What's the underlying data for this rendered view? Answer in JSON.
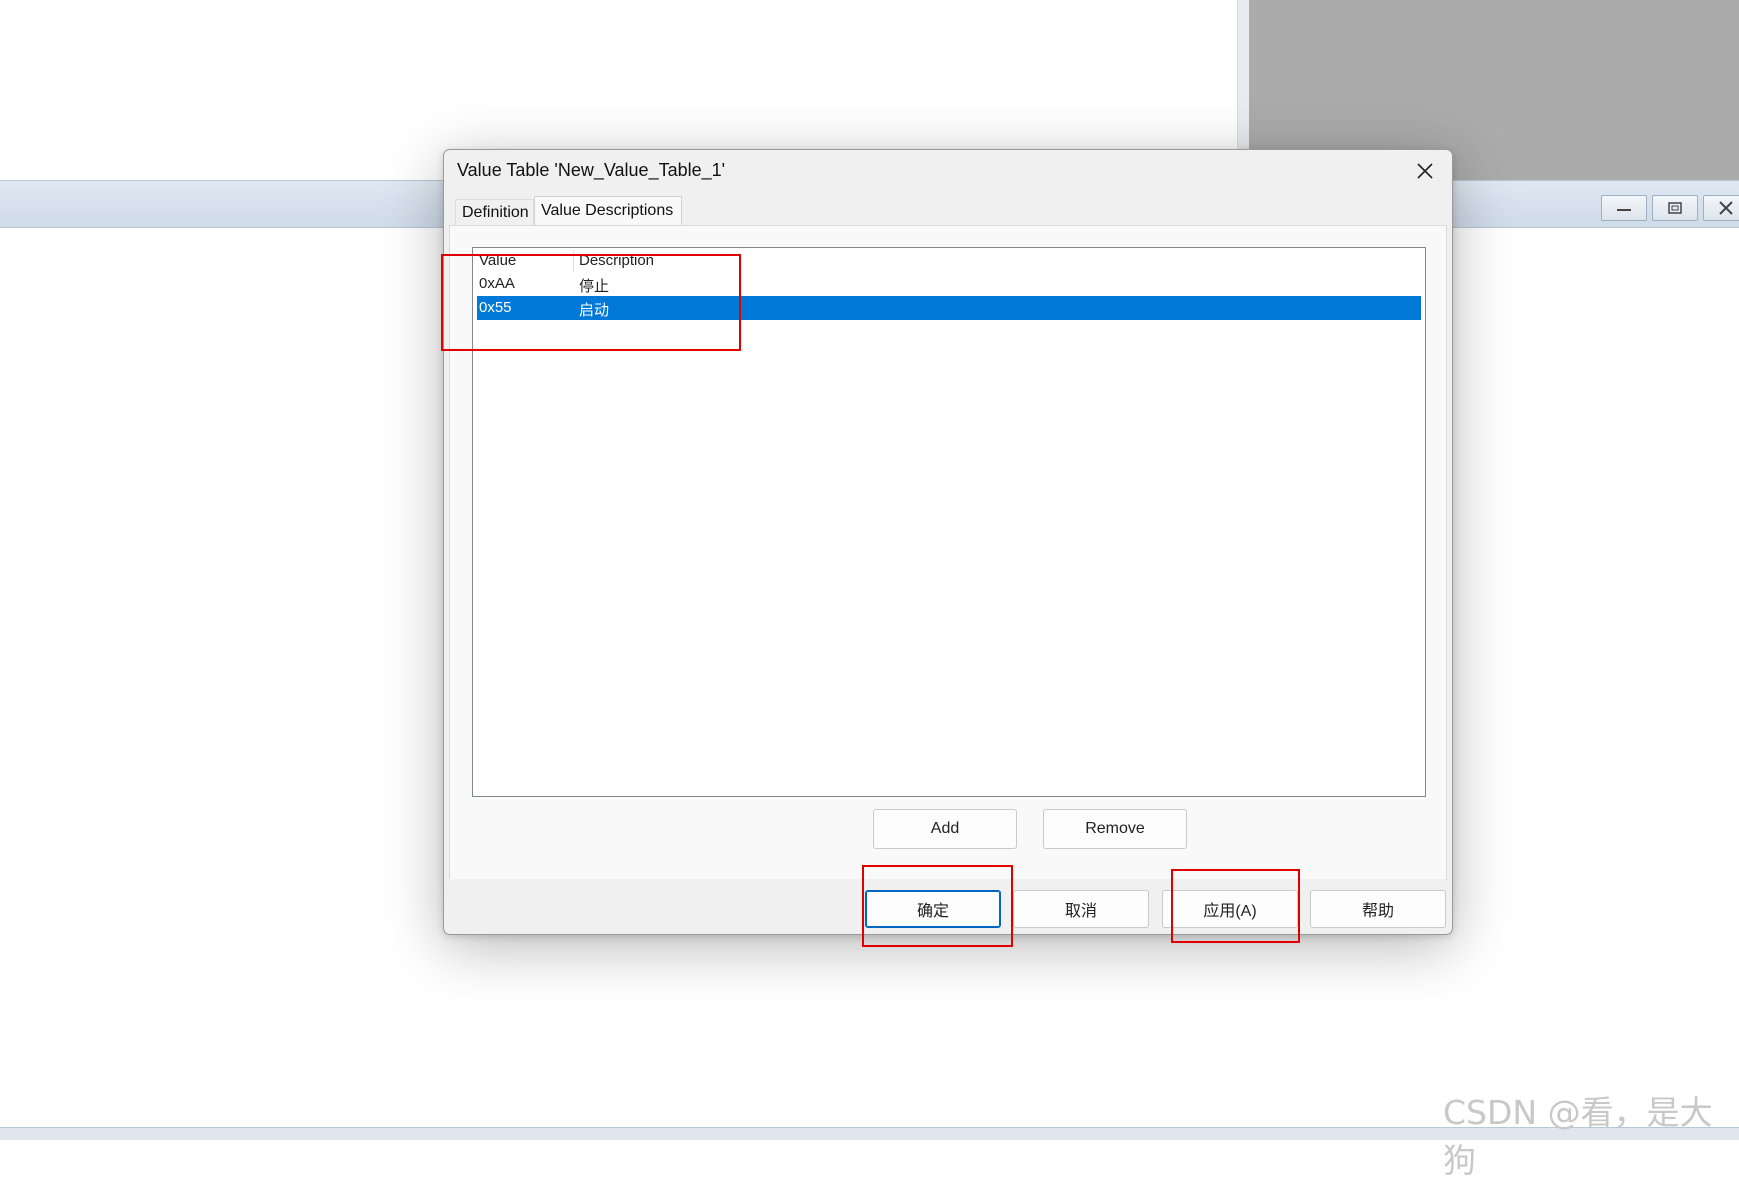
{
  "dialog": {
    "title": "Value Table 'New_Value_Table_1'",
    "tabs": [
      {
        "label": "Definition",
        "active": false
      },
      {
        "label": "Value Descriptions",
        "active": true
      }
    ],
    "list": {
      "columns": [
        "Value",
        "Description"
      ],
      "rows": [
        {
          "value": "0xAA",
          "description": "停止",
          "selected": false
        },
        {
          "value": "0x55",
          "description": "启动",
          "selected": true
        }
      ]
    },
    "add_button": "Add",
    "remove_button": "Remove",
    "footer_buttons": {
      "ok": "确定",
      "cancel": "取消",
      "apply": "应用(A)",
      "help": "帮助"
    }
  },
  "background": {
    "mdi_buttons": [
      "minimize-icon",
      "restore-icon",
      "close-icon"
    ]
  },
  "watermark": "CSDN @看，是大狗",
  "colors": {
    "selection": "#0078d7",
    "annotation": "#e00000",
    "default_button_border": "#0067c0"
  }
}
